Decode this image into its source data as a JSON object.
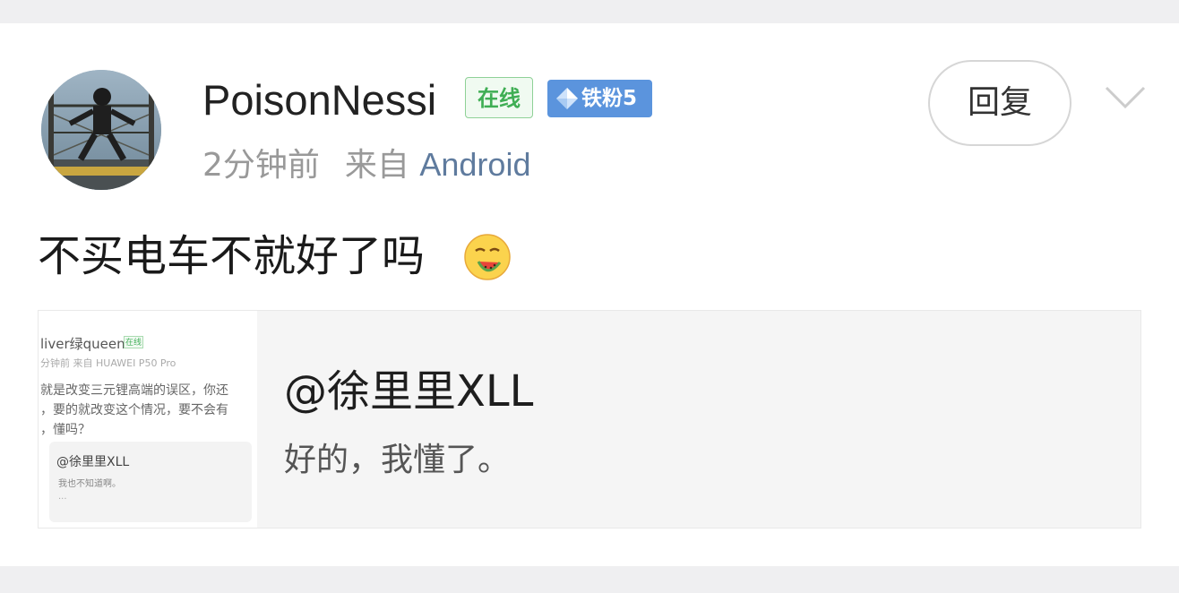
{
  "post": {
    "username": "PoisonNessi",
    "online_badge": "在线",
    "fan_badge": "铁粉5",
    "time": "2分钟前",
    "from_label": "来自",
    "device": "Android",
    "reply_label": "回复",
    "comment": "不买电车不就好了吗",
    "emoji_icon": "drooling-melon-face-emoji"
  },
  "quote": {
    "title": "@徐里里XLL",
    "body": "好的，我懂了。",
    "thumbnail": {
      "name": "liver绿queen",
      "online": "在线",
      "meta": "分钟前  来自 HUAWEI P50 Pro",
      "line1": "就是改变三元锂高端的误区，你还",
      "line2": "，要的就改变这个情况，要不会有",
      "line3": "，懂吗？",
      "inner_at": "@徐里里XLL",
      "inner_text": "我也不知道啊。",
      "inner_more": "..."
    }
  },
  "colors": {
    "online_green": "#3fae54",
    "fan_blue": "#5b94dd",
    "device_blue": "#5f7b9e",
    "meta_gray": "#999999"
  }
}
